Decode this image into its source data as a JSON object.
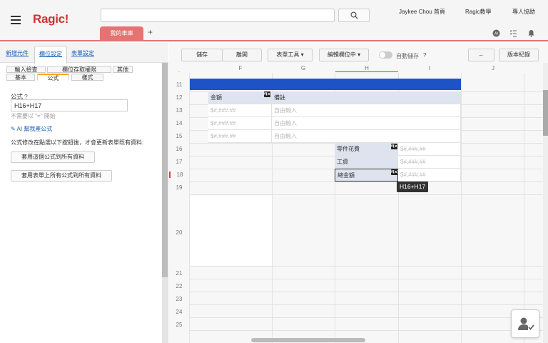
{
  "app": {
    "logo": "Ragic!"
  },
  "topbar": {
    "user_link": "Jaykee Chou 首頁",
    "tutorial_link": "Ragic教學",
    "expert_help_link": "專人協助",
    "active_tab": "我的車庫",
    "add_tab": "+"
  },
  "left_panel": {
    "tabs": [
      "新增元件",
      "欄位設定",
      "表單設定"
    ],
    "subtabs_row1": [
      "輸入檢查",
      "欄位存取權限",
      "其他"
    ],
    "subtabs_row2": [
      "基本",
      "公式",
      "樣式"
    ],
    "formula_label": "公式",
    "formula_help": "?",
    "formula_value": "H16+H17",
    "formula_hint": "不需要以 \"=\" 開始",
    "ai_link": "AI 幫我產公式",
    "notice": "公式修改在點選以下按鈕後，才會更新表單既有資料:",
    "apply_this_button": "套用這個公式到所有資料",
    "apply_all_button": "套用表單上所有公式到所有資料"
  },
  "toolbar": {
    "save": "儲存",
    "leave": "離開",
    "form_tools": "表單工具 ▾",
    "editing": "編輯欄位中 ▾",
    "autosave": "自動儲存",
    "autosave_help": "?",
    "back": "←",
    "history": "版本紀錄"
  },
  "sheet": {
    "columns": [
      "F",
      "G",
      "H",
      "I",
      "J"
    ],
    "header_row_cut": "..",
    "rows": [
      "11",
      "12",
      "13",
      "14",
      "15",
      "16",
      "17",
      "18",
      "19",
      "20",
      "21",
      "22",
      "23",
      "24",
      "25"
    ],
    "amount_header": "金額",
    "note_header": "備註",
    "amount_placeholder": "$#,###.##",
    "note_placeholder": "自由輸入",
    "parts_label": "零件花費",
    "wage_label": "工資",
    "total_label": "總金額",
    "fx_badge": "f(x)",
    "tooltip": "H16+H17"
  },
  "icons": {
    "hamburger": "hamburger-icon",
    "search": "search-icon",
    "ai": "ai-icon",
    "checklist": "checklist-icon",
    "bell": "bell-icon",
    "pencil": "pencil-icon",
    "user_check": "user-check-icon"
  },
  "colors": {
    "brand": "#d32f2f",
    "accent_tab": "#e57373",
    "header_bar": "#1e53c8",
    "link": "#1a5fb4"
  }
}
